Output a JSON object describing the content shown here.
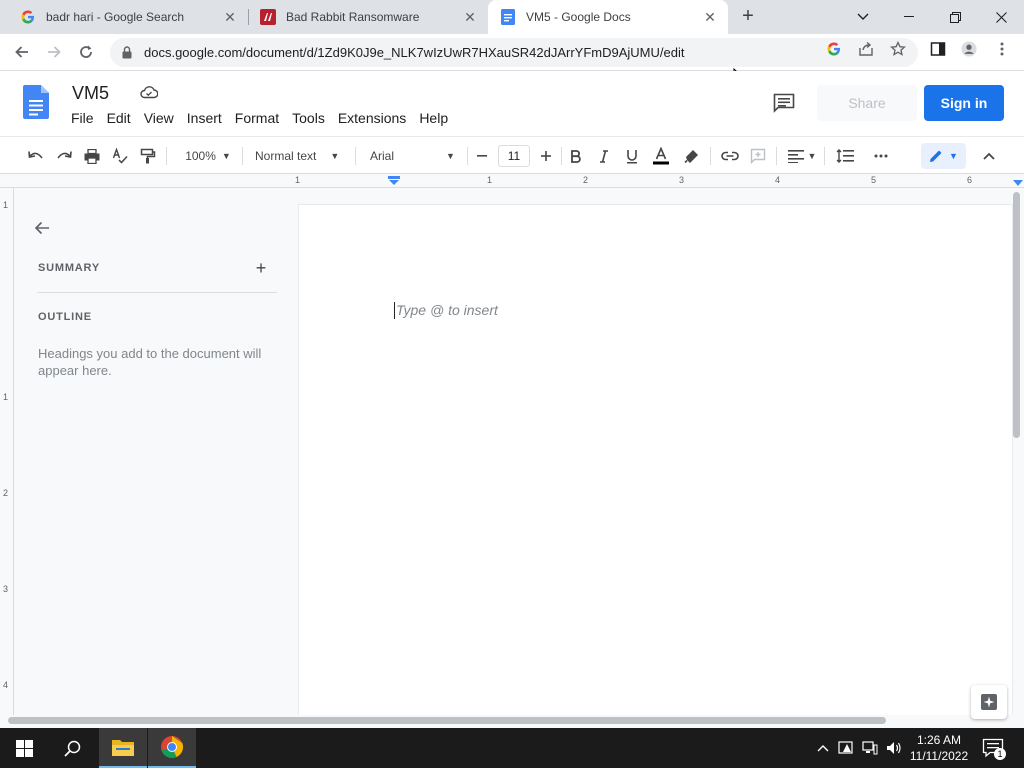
{
  "browser": {
    "tabs": [
      {
        "title": "badr hari - Google Search",
        "close": "✕"
      },
      {
        "title": "Bad Rabbit Ransomware",
        "close": "✕"
      },
      {
        "title": "VM5 - Google Docs",
        "close": "✕"
      }
    ],
    "new_tab": "+",
    "url": "docs.google.com/document/d/1Zd9K0J9e_NLK7wIzUwR7HXauSR42dJArrYFmD9AjUMU/edit"
  },
  "docs": {
    "title": "VM5",
    "menu": [
      "File",
      "Edit",
      "View",
      "Insert",
      "Format",
      "Tools",
      "Extensions",
      "Help"
    ],
    "share_label": "Share",
    "signin_label": "Sign in",
    "accent_color": "#1a73e8"
  },
  "toolbar": {
    "zoom": "100%",
    "style": "Normal text",
    "font": "Arial",
    "font_size": "11"
  },
  "ruler": {
    "h_numbers": [
      "1",
      "1",
      "2",
      "3",
      "4",
      "5",
      "6"
    ],
    "v_numbers": [
      "1",
      "1",
      "2",
      "3",
      "4"
    ]
  },
  "outline_panel": {
    "summary_heading": "SUMMARY",
    "add_label": "+",
    "outline_heading": "OUTLINE",
    "empty_text": "Headings you add to the document will appear here."
  },
  "document": {
    "placeholder": "Type @ to insert"
  },
  "taskbar": {
    "time": "1:26 AM",
    "date": "11/11/2022",
    "notification_count": "1"
  }
}
